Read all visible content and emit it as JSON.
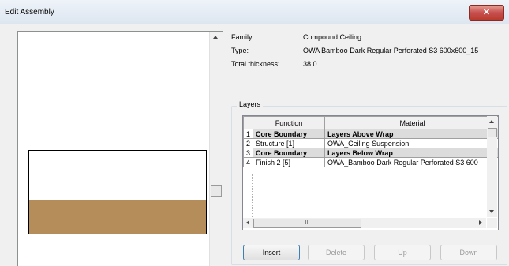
{
  "window": {
    "title": "Edit Assembly",
    "close_glyph": "✕"
  },
  "properties": {
    "family_label": "Family:",
    "family_value": "Compound Ceiling",
    "type_label": "Type:",
    "type_value": "OWA Bamboo Dark Regular Perforated S3 600x600_15",
    "thickness_label": "Total thickness:",
    "thickness_value": "38.0"
  },
  "layers": {
    "group_label": "Layers",
    "columns": [
      "",
      "Function",
      "Material"
    ],
    "rows": [
      {
        "num": "1",
        "function": "Core Boundary",
        "material": "Layers Above Wrap",
        "core": true
      },
      {
        "num": "2",
        "function": "Structure [1]",
        "material": "OWA_Ceiling Suspension",
        "core": false
      },
      {
        "num": "3",
        "function": "Core Boundary",
        "material": "Layers Below Wrap",
        "core": true
      },
      {
        "num": "4",
        "function": "Finish 2 [5]",
        "material": "OWA_Bamboo Dark Regular Perforated S3 600",
        "core": false
      }
    ],
    "hscroll_grip": "III"
  },
  "buttons": {
    "insert": "Insert",
    "delete": "Delete",
    "up": "Up",
    "down": "Down"
  },
  "colors": {
    "finish_layer": "#b48d5b"
  }
}
